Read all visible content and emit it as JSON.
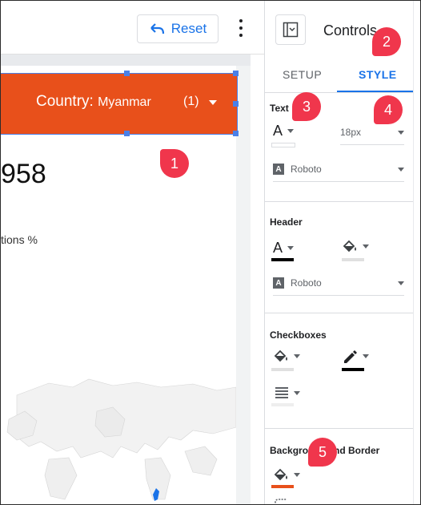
{
  "toolbar": {
    "reset_label": "Reset",
    "reset_icon": "undo-icon",
    "more_icon": "kebab-menu-icon"
  },
  "report": {
    "filter": {
      "field": "Country",
      "value": "Myanmar",
      "count": "(1)"
    },
    "big_number": "958",
    "metric_label": "tions %"
  },
  "panel": {
    "title": "Controls",
    "tabs": [
      "SETUP",
      "STYLE"
    ],
    "active_tab": "STYLE",
    "text_section": {
      "label": "Text",
      "font_size": "18px",
      "font": "Roboto"
    },
    "header_section": {
      "label": "Header",
      "font": "Roboto"
    },
    "checkboxes_section": {
      "label": "Checkboxes"
    },
    "background_section": {
      "label": "Background and Border"
    }
  },
  "annotations": [
    "1",
    "2",
    "3",
    "4",
    "5"
  ],
  "colors": {
    "accent": "#1a73e8",
    "filter_bg": "#e8501b",
    "bubble": "#f0364c",
    "border_swatch": "#e8501b"
  }
}
